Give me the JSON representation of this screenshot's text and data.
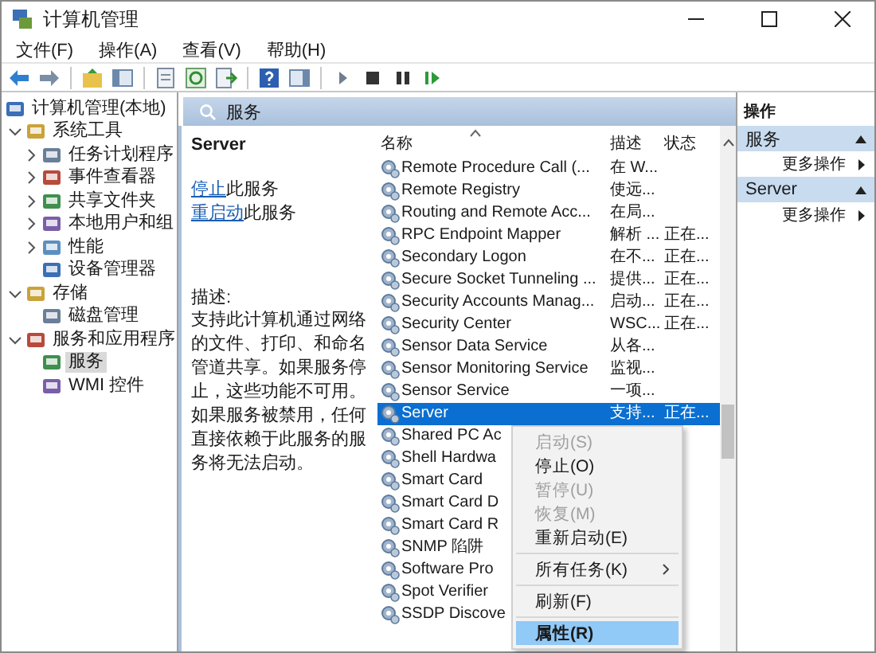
{
  "window": {
    "title": "计算机管理"
  },
  "menu": [
    "文件(F)",
    "操作(A)",
    "查看(V)",
    "帮助(H)"
  ],
  "tree": [
    {
      "label": "计算机管理(本地)",
      "selected": false,
      "children": [
        {
          "kind": "branch",
          "label": "系统工具",
          "expanded": true,
          "selected": false,
          "children": [
            {
              "kind": "branch",
              "label": "任务计划程序",
              "expanded": false,
              "selected": false
            },
            {
              "kind": "branch",
              "label": "事件查看器",
              "expanded": false,
              "selected": false
            },
            {
              "kind": "branch",
              "label": "共享文件夹",
              "expanded": false,
              "selected": false
            },
            {
              "kind": "branch",
              "label": "本地用户和组",
              "expanded": false,
              "selected": false
            },
            {
              "kind": "branch",
              "label": "性能",
              "expanded": false,
              "selected": false
            },
            {
              "kind": "leaf",
              "label": "设备管理器",
              "selected": false
            }
          ]
        },
        {
          "kind": "branch",
          "label": "存储",
          "expanded": true,
          "selected": false,
          "children": [
            {
              "kind": "leaf",
              "label": "磁盘管理",
              "selected": false
            }
          ]
        },
        {
          "kind": "branch",
          "label": "服务和应用程序",
          "expanded": true,
          "selected": false,
          "children": [
            {
              "kind": "leaf",
              "label": "服务",
              "selected": true
            },
            {
              "kind": "leaf",
              "label": "WMI 控件",
              "selected": false
            }
          ]
        }
      ]
    }
  ],
  "center": {
    "title": "服务",
    "service_name": "Server",
    "links": [
      {
        "link": "停止",
        "text": "此服务"
      },
      {
        "link": "重启动",
        "text": "此服务"
      }
    ],
    "description_label": "描述:",
    "description": "支持此计算机通过网络的文件、打印、和命名管道共享。如果服务停止，这些功能不可用。如果服务被禁用，任何直接依赖于此服务的服务将无法启动。"
  },
  "list": {
    "columns": [
      "名称",
      "描述",
      "状态"
    ],
    "rows": [
      {
        "name": "Remote Procedure Call (...",
        "description": "在 W...",
        "status": "",
        "selected": false
      },
      {
        "name": "Remote Registry",
        "description": "使远...",
        "status": "",
        "selected": false
      },
      {
        "name": "Routing and Remote Acc...",
        "description": "在局...",
        "status": "",
        "selected": false
      },
      {
        "name": "RPC Endpoint Mapper",
        "description": "解析 ...",
        "status": "正在...",
        "selected": false
      },
      {
        "name": "Secondary Logon",
        "description": "在不...",
        "status": "正在...",
        "selected": false
      },
      {
        "name": "Secure Socket Tunneling ...",
        "description": "提供...",
        "status": "正在...",
        "selected": false
      },
      {
        "name": "Security Accounts Manag...",
        "description": "启动...",
        "status": "正在...",
        "selected": false
      },
      {
        "name": "Security Center",
        "description": "WSC...",
        "status": "正在...",
        "selected": false
      },
      {
        "name": "Sensor Data Service",
        "description": "从各...",
        "status": "",
        "selected": false
      },
      {
        "name": "Sensor Monitoring Service",
        "description": "监视...",
        "status": "",
        "selected": false
      },
      {
        "name": "Sensor Service",
        "description": "一项...",
        "status": "",
        "selected": false
      },
      {
        "name": "Server",
        "description": "支持...",
        "status": "正在...",
        "selected": true
      },
      {
        "name": "Shared PC Ac",
        "description": "",
        "status": "",
        "selected": false
      },
      {
        "name": "Shell Hardwa",
        "description": "",
        "status": "",
        "selected": false
      },
      {
        "name": "Smart Card",
        "description": "",
        "status": "",
        "selected": false
      },
      {
        "name": "Smart Card D",
        "description": "",
        "status": "",
        "selected": false
      },
      {
        "name": "Smart Card R",
        "description": "",
        "status": "",
        "selected": false
      },
      {
        "name": "SNMP 陷阱",
        "description": "",
        "status": "",
        "selected": false
      },
      {
        "name": "Software Pro",
        "description": "",
        "status": "",
        "selected": false
      },
      {
        "name": "Spot Verifier",
        "description": "",
        "status": "",
        "selected": false
      },
      {
        "name": "SSDP Discove",
        "description": "",
        "status": "",
        "selected": false
      }
    ]
  },
  "actions": {
    "title": "操作",
    "sections": [
      {
        "title": "服务",
        "items": [
          "更多操作"
        ]
      },
      {
        "title": "Server",
        "items": [
          "更多操作"
        ]
      }
    ]
  },
  "context_menu": [
    {
      "kind": "item",
      "label": "启动(S)",
      "disabled": true,
      "selected": false,
      "submenu": false
    },
    {
      "kind": "item",
      "label": "停止(O)",
      "disabled": false,
      "selected": false,
      "submenu": false
    },
    {
      "kind": "item",
      "label": "暂停(U)",
      "disabled": true,
      "selected": false,
      "submenu": false
    },
    {
      "kind": "item",
      "label": "恢复(M)",
      "disabled": true,
      "selected": false,
      "submenu": false
    },
    {
      "kind": "item",
      "label": "重新启动(E)",
      "disabled": false,
      "selected": false,
      "submenu": false
    },
    {
      "kind": "separator"
    },
    {
      "kind": "item",
      "label": "所有任务(K)",
      "disabled": false,
      "selected": false,
      "submenu": true
    },
    {
      "kind": "separator"
    },
    {
      "kind": "item",
      "label": "刷新(F)",
      "disabled": false,
      "selected": false,
      "submenu": false
    },
    {
      "kind": "separator"
    },
    {
      "kind": "item",
      "label": "属性(R)",
      "disabled": false,
      "selected": true,
      "submenu": false
    }
  ]
}
